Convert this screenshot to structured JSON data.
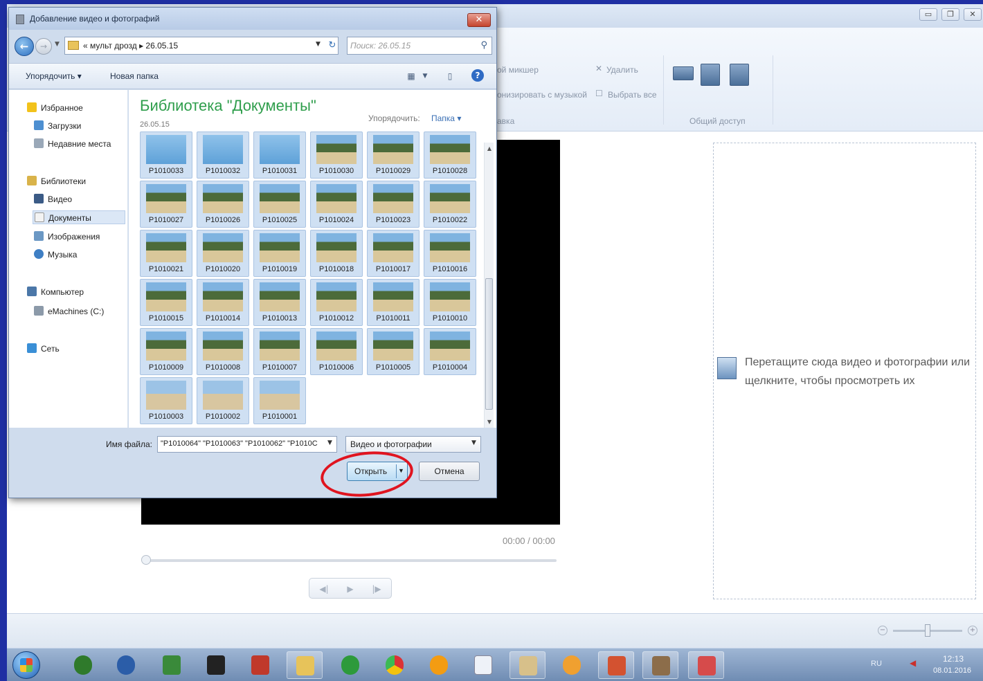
{
  "dialog": {
    "title": "Добавление видео и фотографий",
    "address_path": "« мульт дрозд ▸ 26.05.15",
    "search_placeholder": "Поиск: 26.05.15",
    "toolbar": {
      "organize": "Упорядочить ▾",
      "new_folder": "Новая папка"
    },
    "nav": {
      "favorites": "Избранное",
      "downloads": "Загрузки",
      "recent": "Недавние места",
      "libraries": "Библиотеки",
      "video": "Видео",
      "documents": "Документы",
      "pictures": "Изображения",
      "music": "Музыка",
      "computer": "Компьютер",
      "drive_c": "eMachines (C:)",
      "network": "Сеть"
    },
    "library_title": "Библиотека \"Документы\"",
    "library_subtitle": "26.05.15",
    "arrange_label": "Упорядочить:",
    "arrange_value": "Папка ▾",
    "files": [
      "P1010033",
      "P1010032",
      "P1010031",
      "P1010030",
      "P1010029",
      "P1010028",
      "P1010027",
      "P1010026",
      "P1010025",
      "P1010024",
      "P1010023",
      "P1010022",
      "P1010021",
      "P1010020",
      "P1010019",
      "P1010018",
      "P1010017",
      "P1010016",
      "P1010015",
      "P1010014",
      "P1010013",
      "P1010012",
      "P1010011",
      "P1010010",
      "P1010009",
      "P1010008",
      "P1010007",
      "P1010006",
      "P1010005",
      "P1010004",
      "P1010003",
      "P1010002",
      "P1010001"
    ],
    "filename_label": "Имя файла:",
    "filename_value": "\"P1010064\" \"P1010063\" \"P1010062\" \"P1010C",
    "filetype_value": "Видео и фотографии",
    "open_label": "Открыть",
    "cancel_label": "Отмена"
  },
  "app": {
    "ribbon": {
      "mixer": "ой микшер",
      "delete": "Удалить",
      "sync_music": "онизировать с музыкой",
      "select_all": "Выбрать все",
      "edit_group": "авка",
      "share_group": "Общий доступ"
    },
    "time_readout": "00:00 / 00:00",
    "storyboard_hint": "Перетащите сюда видео и фотографии или щелкните, чтобы просмотреть их"
  },
  "taskbar": {
    "lang": "RU",
    "time": "12:13",
    "date": "08.01.2016"
  },
  "colors": {
    "accent_blue": "#1f2fa3",
    "library_green": "#2f9e4c",
    "annotation_red": "#e0141f"
  }
}
